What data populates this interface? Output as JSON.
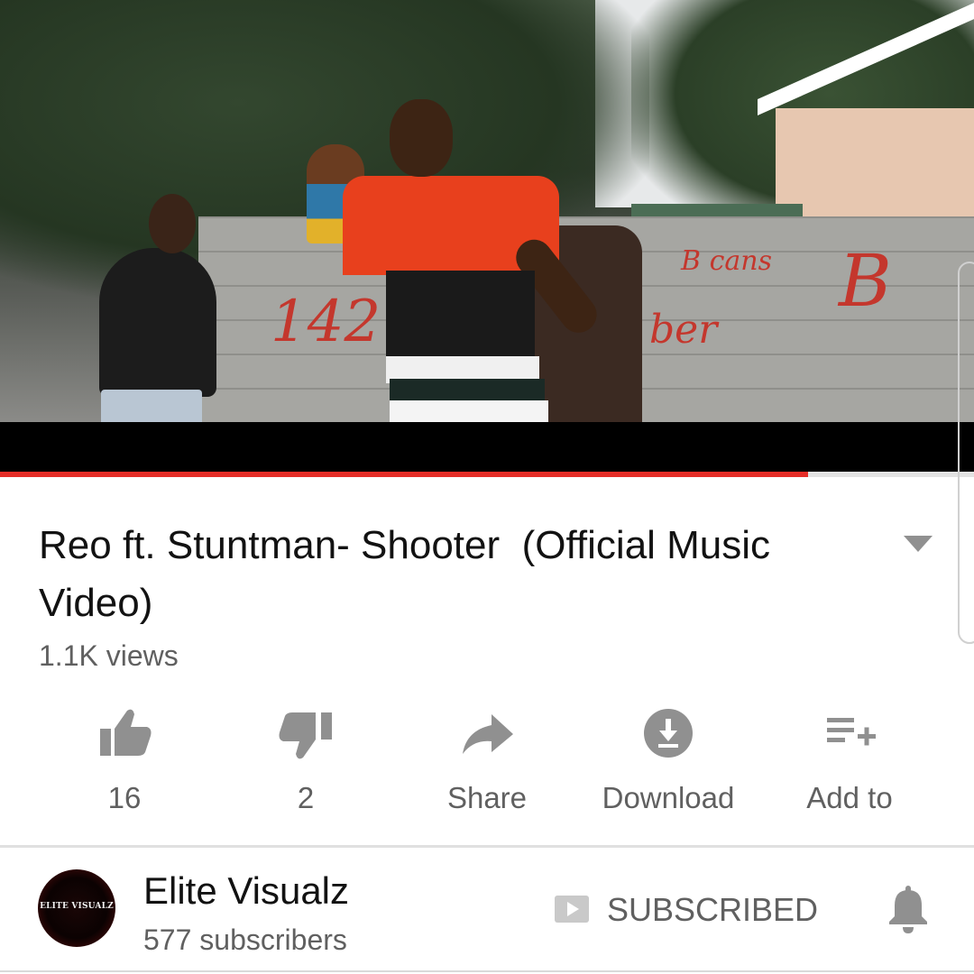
{
  "video": {
    "progress_fraction": 0.83,
    "progress_color": "#e52d27"
  },
  "details": {
    "title": "Reo ft. Stuntman- Shooter  (Official Music Video)",
    "views": "1.1K views"
  },
  "actions": [
    {
      "icon": "thumbs-up-icon",
      "label": "16"
    },
    {
      "icon": "thumbs-down-icon",
      "label": "2"
    },
    {
      "icon": "share-arrow-icon",
      "label": "Share"
    },
    {
      "icon": "download-icon",
      "label": "Download"
    },
    {
      "icon": "playlist-add-icon",
      "label": "Add to"
    }
  ],
  "channel": {
    "name": "Elite Visualz",
    "subscribers": "577 subscribers",
    "avatar_text": "ELITE VISUALZ",
    "subscribe_label": "SUBSCRIBED",
    "bell_icon": "notification-bell-icon"
  },
  "colors": {
    "icon_gray": "#909090",
    "text_gray": "#606060",
    "accent_red": "#e52d27"
  }
}
